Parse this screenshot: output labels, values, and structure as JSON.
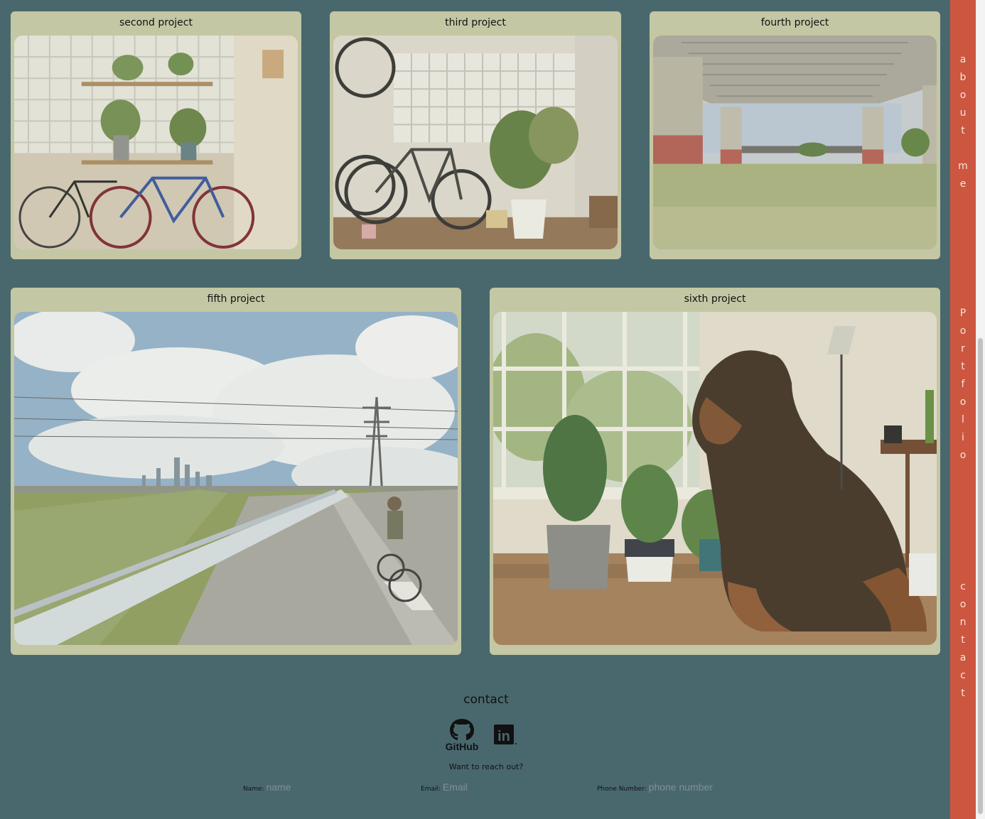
{
  "projects": [
    {
      "title": "second project"
    },
    {
      "title": "third project"
    },
    {
      "title": "fourth project"
    },
    {
      "title": "fifth project"
    },
    {
      "title": "sixth project"
    }
  ],
  "sidebar": {
    "about": "about me",
    "portfolio": "Portfolio",
    "contact": "contact"
  },
  "contact": {
    "title": "contact",
    "prompt": "Want to reach out?",
    "github_icon": "github-icon",
    "github_label": "GitHub",
    "linkedin_icon": "linkedin-icon",
    "linkedin_label": "in",
    "name_label": "Name:",
    "name_placeholder": "name",
    "email_label": "Email:",
    "email_placeholder": "Email",
    "phone_label": "Phone Number:",
    "phone_placeholder": "phone number"
  },
  "colors": {
    "background": "#49686e",
    "card": "#c4c7a3",
    "sidebar": "#cc5640"
  }
}
